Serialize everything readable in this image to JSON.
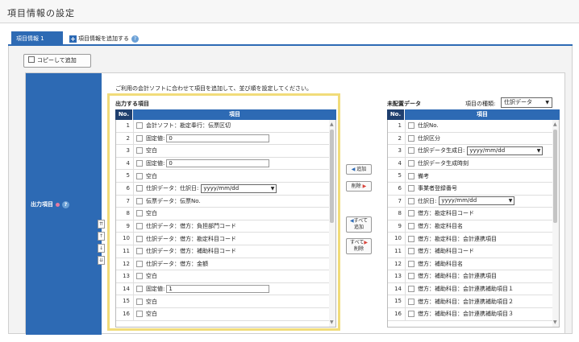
{
  "page": {
    "title": "項目情報の設定"
  },
  "tabs": {
    "active_label": "項目情報 1",
    "add_label": "項目情報を追加する",
    "add_icon": "plus-icon",
    "help_icon": "help-circle-icon"
  },
  "toolbar": {
    "copy_label": "コピーして追加",
    "copy_icon": "copy-icon"
  },
  "form": {
    "field_label": "出力項目",
    "description": "ご利用の会計ソフトに合わせて項目を追加して、並び順を設定してください。"
  },
  "output_list": {
    "title": "出力する項目",
    "col_no": "No.",
    "col_item": "項目",
    "rows": [
      {
        "no": "1",
        "text": "会計ソフト：勘定奉行：伝票区切"
      },
      {
        "no": "2",
        "text": "固定値:",
        "input_value": "0"
      },
      {
        "no": "3",
        "text": "空白"
      },
      {
        "no": "4",
        "text": "固定値:",
        "input_value": "0"
      },
      {
        "no": "5",
        "text": "空白"
      },
      {
        "no": "6",
        "text": "仕訳データ：仕訳日:",
        "select_value": "yyyy/mm/dd"
      },
      {
        "no": "7",
        "text": "伝票データ：伝票No."
      },
      {
        "no": "8",
        "text": "空白"
      },
      {
        "no": "9",
        "text": "仕訳データ：借方：負担部門コード"
      },
      {
        "no": "10",
        "text": "仕訳データ：借方：勘定科目コード"
      },
      {
        "no": "11",
        "text": "仕訳データ：借方：補助科目コード"
      },
      {
        "no": "12",
        "text": "仕訳データ：借方：金額"
      },
      {
        "no": "13",
        "text": "空白"
      },
      {
        "no": "14",
        "text": "固定値:",
        "input_value": "1"
      },
      {
        "no": "15",
        "text": "空白"
      },
      {
        "no": "16",
        "text": "空白"
      }
    ]
  },
  "order_buttons": [
    "⇈",
    "↑",
    "↓",
    "⇊"
  ],
  "transfer_buttons": {
    "add": "追加",
    "remove": "削除",
    "add_all_line1": "すべて",
    "add_all_line2": "追加",
    "remove_all_line1": "すべて",
    "remove_all_line2": "削除"
  },
  "unassigned_list": {
    "title": "未配置データ",
    "kind_label": "項目の種類:",
    "kind_value": "仕訳データ",
    "col_no": "No.",
    "col_item": "項目",
    "rows": [
      {
        "no": "1",
        "text": "仕訳No."
      },
      {
        "no": "2",
        "text": "仕訳区分"
      },
      {
        "no": "3",
        "text": "仕訳データ生成日:",
        "select_value": "yyyy/mm/dd"
      },
      {
        "no": "4",
        "text": "仕訳データ生成時刻"
      },
      {
        "no": "5",
        "text": "備考"
      },
      {
        "no": "6",
        "text": "事業者登録番号"
      },
      {
        "no": "7",
        "text": "仕訳日:",
        "select_value": "yyyy/mm/dd"
      },
      {
        "no": "8",
        "text": "借方：勘定科目コード"
      },
      {
        "no": "9",
        "text": "借方：勘定科目名"
      },
      {
        "no": "10",
        "text": "借方：勘定科目：会計連携項目"
      },
      {
        "no": "11",
        "text": "借方：補助科目コード"
      },
      {
        "no": "12",
        "text": "借方：補助科目名"
      },
      {
        "no": "13",
        "text": "借方：補助科目：会計連携項目"
      },
      {
        "no": "14",
        "text": "借方：補助科目：会計連携補助項目１"
      },
      {
        "no": "15",
        "text": "借方：補助科目：会計連携補助項目２"
      },
      {
        "no": "16",
        "text": "借方：補助科目：会計連携補助項目３"
      }
    ]
  },
  "colors": {
    "accent": "#2d6ab4",
    "header_dark": "#1f3f6e",
    "highlight": "#f1dc7a",
    "arrow_red": "#d9443a"
  }
}
